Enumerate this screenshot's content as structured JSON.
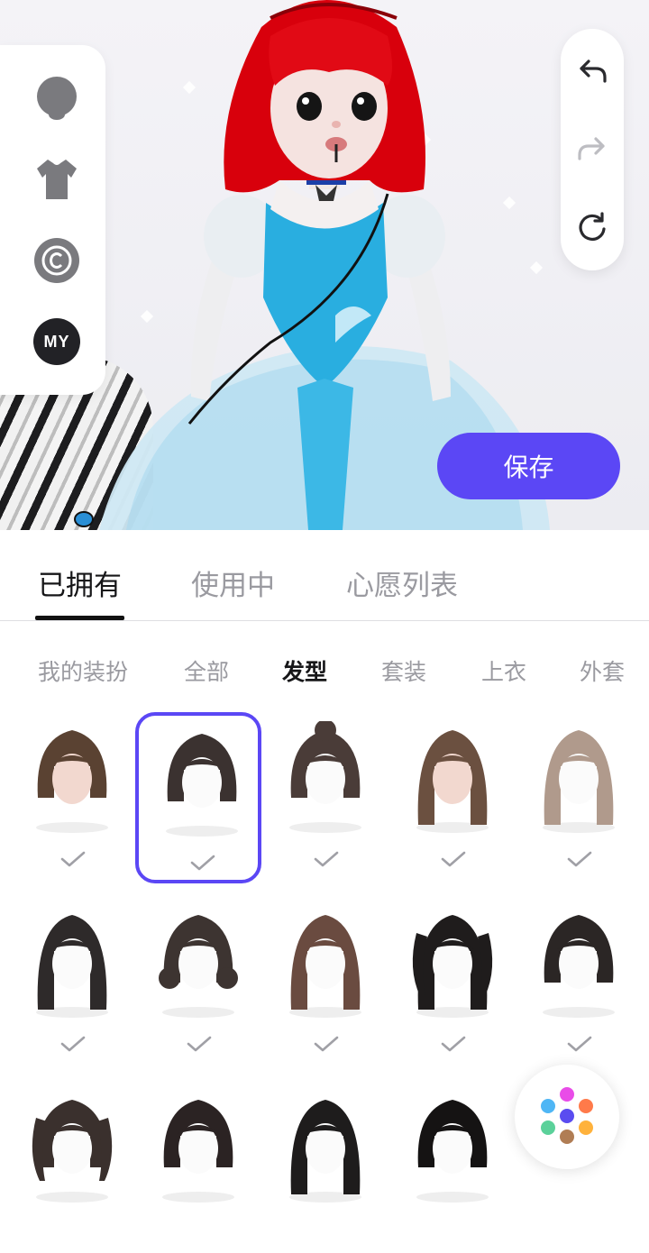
{
  "history": {
    "undo_icon": "undo-icon",
    "redo_icon": "redo-icon",
    "reset_icon": "refresh-icon"
  },
  "category_rail": {
    "items": [
      {
        "icon": "head-icon"
      },
      {
        "icon": "tshirt-icon"
      },
      {
        "icon": "copyright-icon"
      },
      {
        "icon": "my-badge",
        "label": "MY"
      }
    ]
  },
  "save_label": "保存",
  "tabs": [
    {
      "label": "已拥有",
      "active": true
    },
    {
      "label": "使用中",
      "active": false
    },
    {
      "label": "心愿列表",
      "active": false
    }
  ],
  "subtabs": [
    {
      "label": "我的装扮",
      "active": false
    },
    {
      "label": "全部",
      "active": false
    },
    {
      "label": "发型",
      "active": true
    },
    {
      "label": "套装",
      "active": false
    },
    {
      "label": "上衣",
      "active": false
    },
    {
      "label": "外套",
      "active": false
    }
  ],
  "hair_items": [
    {
      "name": "short-bob-bangs-brown",
      "owned": true,
      "selected": false
    },
    {
      "name": "braided-bob-dark",
      "owned": true,
      "selected": true
    },
    {
      "name": "top-bun-dark",
      "owned": true,
      "selected": false
    },
    {
      "name": "long-straight-brown",
      "owned": true,
      "selected": false
    },
    {
      "name": "long-ribbon-light",
      "owned": true,
      "selected": false
    },
    {
      "name": "long-straight-black",
      "owned": true,
      "selected": false
    },
    {
      "name": "low-buns-dark",
      "owned": true,
      "selected": false
    },
    {
      "name": "twin-braids-brown",
      "owned": true,
      "selected": false
    },
    {
      "name": "twin-tails-black",
      "owned": true,
      "selected": false
    },
    {
      "name": "short-bob-black",
      "owned": true,
      "selected": false
    },
    {
      "name": "pigtails-dark",
      "owned": false,
      "selected": false
    },
    {
      "name": "medium-dark",
      "owned": false,
      "selected": false
    },
    {
      "name": "long-dark",
      "owned": false,
      "selected": false
    },
    {
      "name": "clip-bob-black",
      "owned": false,
      "selected": false
    }
  ],
  "palette_icon": "color-palette-icon",
  "colors": {
    "accent": "#5b47f5",
    "tab_active": "#161618",
    "tab_inactive": "#9a9aa0",
    "check": "#a0a0a6"
  }
}
